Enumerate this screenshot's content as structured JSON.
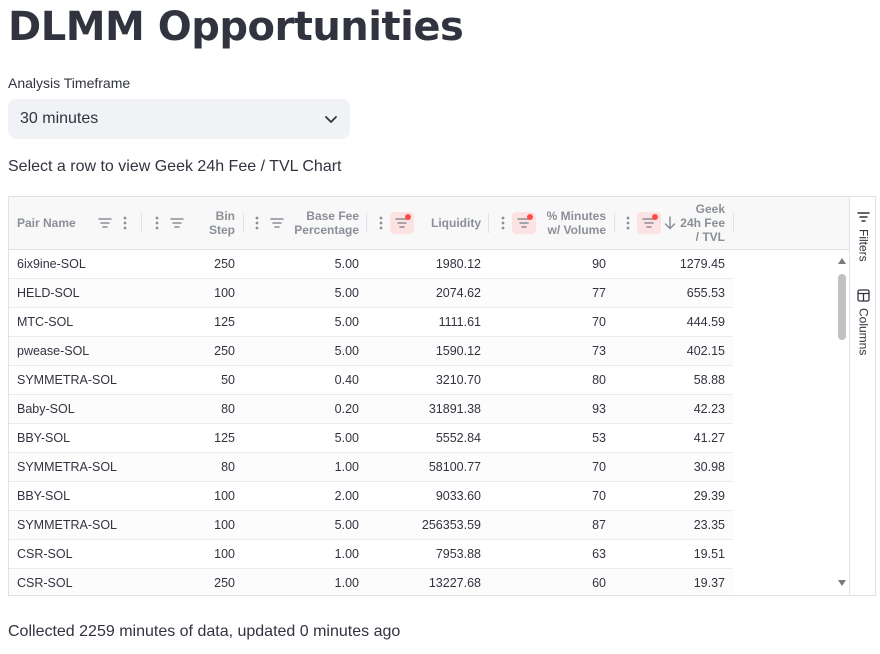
{
  "page": {
    "title": "DLMM Opportunities",
    "timeframe_label": "Analysis Timeframe",
    "timeframe_value": "30 minutes",
    "row_hint": "Select a row to view Geek 24h Fee / TVL Chart",
    "footer": "Collected 2259 minutes of data, updated 0 minutes ago"
  },
  "grid": {
    "columns": [
      {
        "key": "pair",
        "label": "Pair Name"
      },
      {
        "key": "bin",
        "label1": "Bin",
        "label2": "Step"
      },
      {
        "key": "fee",
        "label1": "Base Fee",
        "label2": "Percentage"
      },
      {
        "key": "liq",
        "label": "Liquidity"
      },
      {
        "key": "pct",
        "label1": "% Minutes",
        "label2": "w/ Volume"
      },
      {
        "key": "geek",
        "label1": "Geek",
        "label2": "24h Fee",
        "label3": "/ TVL",
        "sort": "descending"
      }
    ],
    "rows": [
      {
        "pair": "6ix9ine-SOL",
        "bin": "250",
        "fee": "5.00",
        "liq": "1980.12",
        "pct": "90",
        "geek": "1279.45"
      },
      {
        "pair": "HELD-SOL",
        "bin": "100",
        "fee": "5.00",
        "liq": "2074.62",
        "pct": "77",
        "geek": "655.53"
      },
      {
        "pair": "MTC-SOL",
        "bin": "125",
        "fee": "5.00",
        "liq": "1111.61",
        "pct": "70",
        "geek": "444.59"
      },
      {
        "pair": "pwease-SOL",
        "bin": "250",
        "fee": "5.00",
        "liq": "1590.12",
        "pct": "73",
        "geek": "402.15"
      },
      {
        "pair": "SYMMETRA-SOL",
        "bin": "50",
        "fee": "0.40",
        "liq": "3210.70",
        "pct": "80",
        "geek": "58.88"
      },
      {
        "pair": "Baby-SOL",
        "bin": "80",
        "fee": "0.20",
        "liq": "31891.38",
        "pct": "93",
        "geek": "42.23"
      },
      {
        "pair": "BBY-SOL",
        "bin": "125",
        "fee": "5.00",
        "liq": "5552.84",
        "pct": "53",
        "geek": "41.27"
      },
      {
        "pair": "SYMMETRA-SOL",
        "bin": "80",
        "fee": "1.00",
        "liq": "58100.77",
        "pct": "70",
        "geek": "30.98"
      },
      {
        "pair": "BBY-SOL",
        "bin": "100",
        "fee": "2.00",
        "liq": "9033.60",
        "pct": "70",
        "geek": "29.39"
      },
      {
        "pair": "SYMMETRA-SOL",
        "bin": "100",
        "fee": "5.00",
        "liq": "256353.59",
        "pct": "87",
        "geek": "23.35"
      },
      {
        "pair": "CSR-SOL",
        "bin": "100",
        "fee": "1.00",
        "liq": "7953.88",
        "pct": "63",
        "geek": "19.51"
      },
      {
        "pair": "CSR-SOL",
        "bin": "250",
        "fee": "1.00",
        "liq": "13227.68",
        "pct": "60",
        "geek": "19.37"
      }
    ],
    "side_panel": {
      "filters": "Filters",
      "columns": "Columns"
    }
  },
  "icons": {
    "chevron": "chevron-down-icon",
    "filter": "filter-icon",
    "menu": "column-menu-icon",
    "sort": "sort-descending-icon",
    "columns": "columns-icon"
  },
  "colors": {
    "accent_red": "#ff4b4b",
    "active_filter_bg": "#fde2e2",
    "select_bg": "#f0f2f6"
  }
}
